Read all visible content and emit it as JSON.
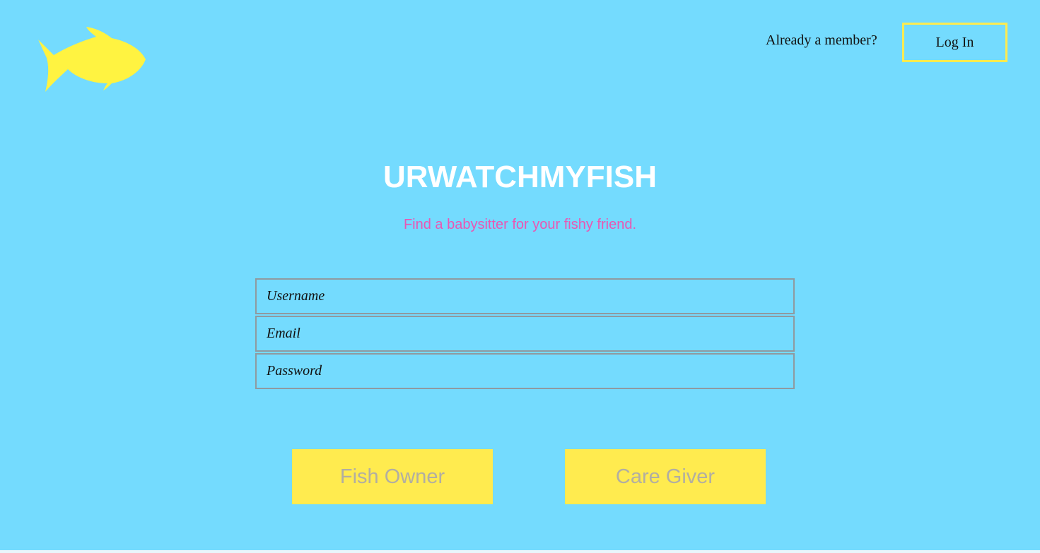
{
  "header": {
    "logo_icon": "fish-icon",
    "logo_color": "#fff341",
    "member_prompt": "Already a member?",
    "login_label": "Log In"
  },
  "hero": {
    "title": "URWATCHMYFISH",
    "subtitle": "Find a babysitter for your fishy friend."
  },
  "form": {
    "username_placeholder": "Username",
    "email_placeholder": "Email",
    "password_placeholder": "Password"
  },
  "roles": {
    "owner_label": "Fish Owner",
    "giver_label": "Care Giver"
  },
  "colors": {
    "background": "#74dbfe",
    "accent": "#ffeb4f",
    "subtitle": "#e957b3",
    "button_text": "#b2aea1"
  }
}
